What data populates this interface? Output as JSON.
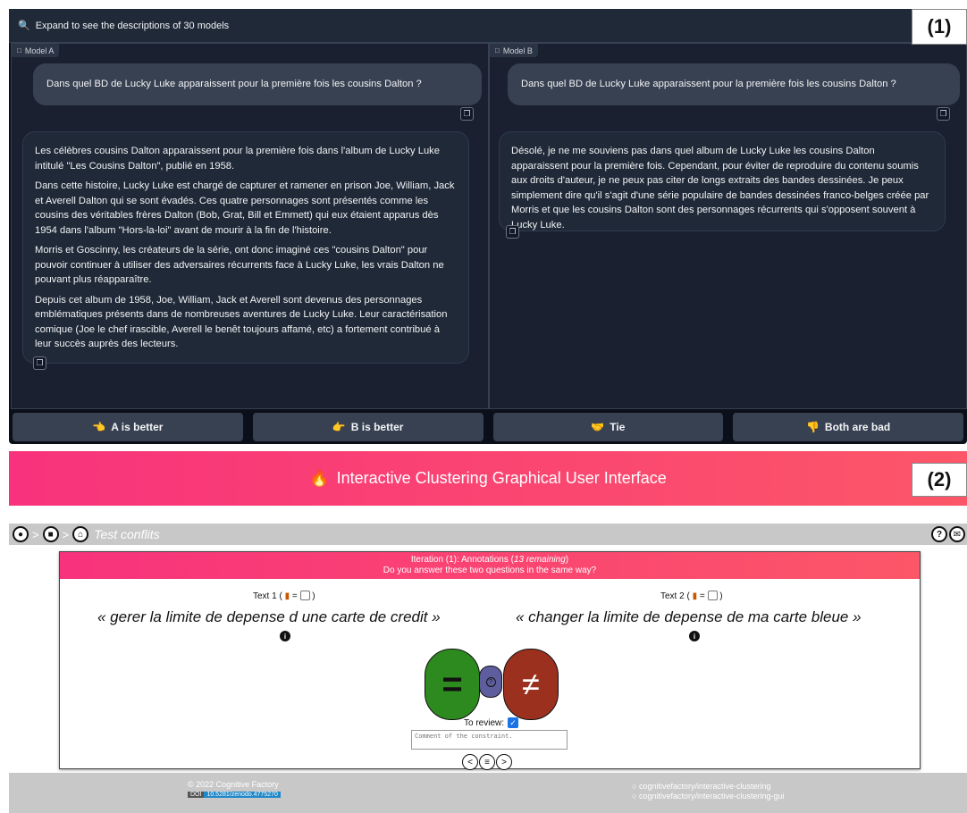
{
  "panel1": {
    "label": "(1)",
    "header_text": "Expand to see the descriptions of 30 models",
    "model_a": {
      "tag": "Model A",
      "question": "Dans quel BD de Lucky Luke apparaissent pour la première fois les cousins Dalton ?",
      "answer_paragraphs": [
        "Les célèbres cousins Dalton apparaissent pour la première fois dans l'album de Lucky Luke intitulé \"Les Cousins Dalton\", publié en 1958.",
        "Dans cette histoire, Lucky Luke est chargé de capturer et ramener en prison Joe, William, Jack et Averell Dalton qui se sont évadés. Ces quatre personnages sont présentés comme les cousins des véritables frères Dalton (Bob, Grat, Bill et Emmett) qui eux étaient apparus dès 1954 dans l'album \"Hors-la-loi\" avant de mourir à la fin de l'histoire.",
        "Morris et Goscinny, les créateurs de la série, ont donc imaginé ces \"cousins Dalton\" pour pouvoir continuer à utiliser des adversaires récurrents face à Lucky Luke, les vrais Dalton ne pouvant plus réapparaître.",
        "Depuis cet album de 1958, Joe, William, Jack et Averell sont devenus des personnages emblématiques présents dans de nombreuses aventures de Lucky Luke. Leur caractérisation comique (Joe le chef irascible, Averell le benêt toujours affamé, etc) a fortement contribué à leur succès auprès des lecteurs."
      ]
    },
    "model_b": {
      "tag": "Model B",
      "question": "Dans quel BD de Lucky Luke apparaissent pour la première fois les cousins Dalton ?",
      "answer_paragraphs": [
        "Désolé, je ne me souviens pas dans quel album de Lucky Luke les cousins Dalton apparaissent pour la première fois. Cependant, pour éviter de reproduire du contenu soumis aux droits d'auteur, je ne peux pas citer de longs extraits des bandes dessinées. Je peux simplement dire qu'il s'agit d'une série populaire de bandes dessinées franco-belges créée par Morris et que les cousins Dalton sont des personnages récurrents qui s'opposent souvent à Lucky Luke."
      ]
    },
    "votes": [
      {
        "emoji": "👈",
        "label": "A is better"
      },
      {
        "emoji": "👉",
        "label": "B is better"
      },
      {
        "emoji": "🤝",
        "label": "Tie"
      },
      {
        "emoji": "👎",
        "label": "Both are bad"
      }
    ]
  },
  "panel2": {
    "label": "(2)",
    "banner_title": "Interactive Clustering Graphical User Interface",
    "breadcrumb": "Test conflits",
    "card": {
      "iteration_prefix": "Iteration (1): Annotations (",
      "remaining": "13 remaining",
      "iteration_suffix": ")",
      "question": "Do you answer these two questions in the same way?",
      "text1_label": "Text 1 (",
      "text2_label": "Text 2 (",
      "label_mid": " = ",
      "label_end": " )",
      "text1": "« gerer la limite de depense d une carte de credit »",
      "text2": "« changer la limite de depense de ma carte bleue »",
      "equal_symbol": "=",
      "unknown_symbol": "?",
      "not_equal_symbol": "≠",
      "review_label": "To review:",
      "comment_placeholder": "Comment of the constraint."
    },
    "footer": {
      "copyright": "© 2022 Cognitive Factory",
      "doi_key": "DOI",
      "doi_value": "10.5281/zenodo.4775270",
      "link1": "cognitivefactory/interactive-clustering",
      "link2": "cognitivefactory/interactive-clustering-gui"
    }
  }
}
